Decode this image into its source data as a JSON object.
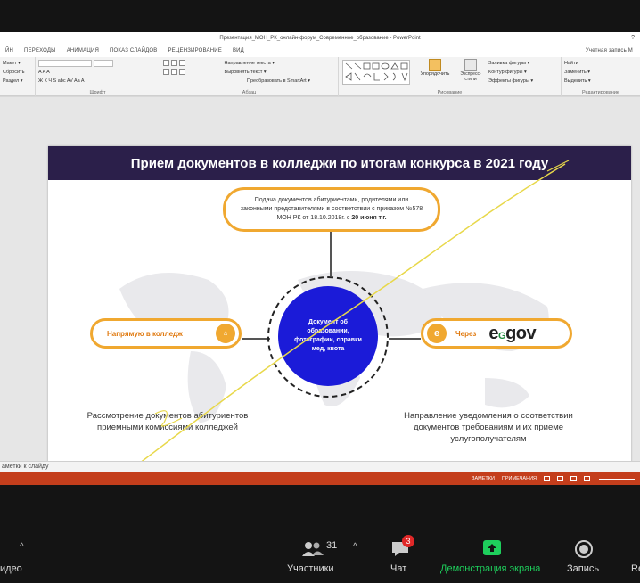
{
  "ppt": {
    "title": "Презентация_МОН_РК_онлайн-форум_Современное_образование - PowerPoint",
    "help": "?",
    "tabs": [
      "ЙН",
      "ПЕРЕХОДЫ",
      "АНИМАЦИЯ",
      "ПОКАЗ СЛАЙДОВ",
      "РЕЦЕНЗИРОВАНИЕ",
      "ВИД"
    ],
    "account": "Учетная запись M",
    "ribbon": {
      "groups": [
        {
          "label": "",
          "lines": [
            "Макет ▾",
            "Сбросить",
            "Раздел ▾"
          ]
        },
        {
          "label": "Шрифт",
          "lines": [
            "",
            "A A A",
            "Ж К Ч S abc AV Aa A"
          ]
        },
        {
          "label": "Абзац",
          "lines": [
            "Направление текста ▾",
            "Выровнять текст ▾",
            "Преобразовать в SmartArt ▾"
          ]
        },
        {
          "label": "Рисование",
          "lines": [
            "Упорядочить",
            "Экспресс-стили",
            "Заливка фигуры ▾",
            "Контур фигуры ▾",
            "Эффекты фигуры ▾"
          ]
        },
        {
          "label": "Редактирование",
          "lines": [
            "Найти",
            "Заменить ▾",
            "Выделить ▾"
          ]
        }
      ]
    },
    "notes_label": "аметки к слайду",
    "status": {
      "notes": "ЗАМЕТКИ",
      "comments": "ПРИМЕЧАНИЯ"
    }
  },
  "slide": {
    "title": "Прием документов в колледжи по итогам конкурса в 2021 году",
    "top_box_text": "Подача документов абитуриентами, родителями или законными представителями в соответствии с приказом №578 МОН РК от 18.10.2018г. с",
    "top_box_bold": "20 июня т.г.",
    "center_text": "Документ об образовании, фотографии, справки мед, квота",
    "left_pill": "Напрямую в колледж",
    "left_badge": "⌂",
    "right_pill_prefix": "Через",
    "egov_e": "e",
    "egov_sub": "G",
    "egov_rest": "gov",
    "egov_badge": "e",
    "left_caption": "Рассмотрение документов абитуриентов приемными комиссиями колледжей",
    "right_caption": "Направление уведомления о соответствии документов требованиям и их приеме услугополучателям"
  },
  "zoom": {
    "video_label": "идео",
    "participants_label": "Участники",
    "participants_count": "31",
    "chat_label": "Чат",
    "chat_badge": "3",
    "share_label": "Демонстрация экрана",
    "record_label": "Запись",
    "reactions_label": "Re",
    "caret": "^"
  },
  "colors": {
    "accent_orange": "#f0a830",
    "header_purple": "#2b1f4a",
    "center_blue": "#1b1bd8",
    "share_green": "#1ecf5c",
    "status_red": "#c43e1c"
  }
}
